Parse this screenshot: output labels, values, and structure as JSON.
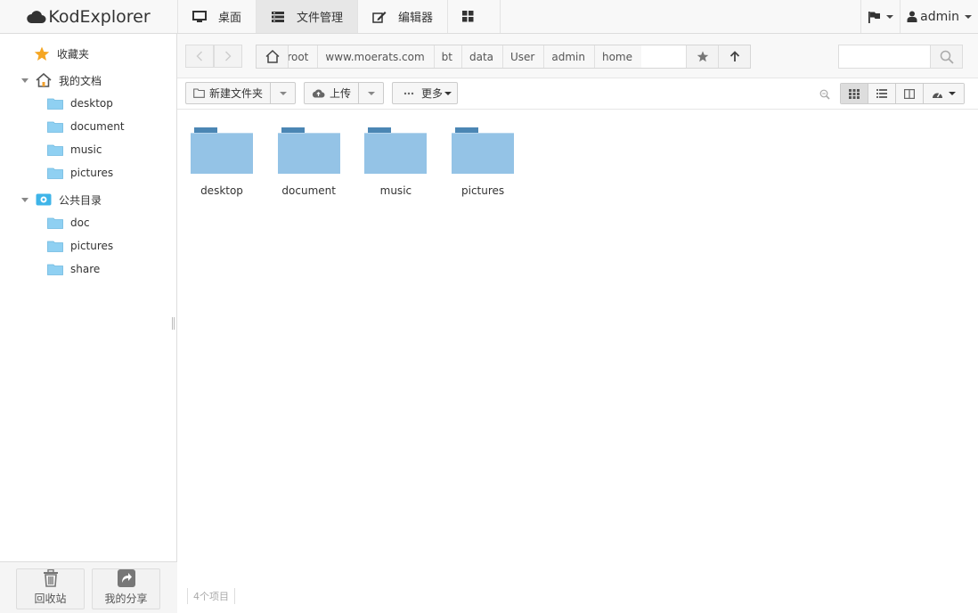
{
  "app": {
    "title": "KodExplorer"
  },
  "topnav": {
    "desktop": "桌面",
    "file_manager": "文件管理",
    "editor": "编辑器"
  },
  "topright": {
    "user": "admin"
  },
  "sidebar": {
    "favorites": "收藏夹",
    "my_docs": "我的文档",
    "my_docs_children": [
      "desktop",
      "document",
      "music",
      "pictures"
    ],
    "public": "公共目录",
    "public_children": [
      "doc",
      "pictures",
      "share"
    ],
    "recycle": "回收站",
    "my_share": "我的分享"
  },
  "path": {
    "crumbs": [
      "/wwroot",
      "www.moerats.com",
      "bt",
      "data",
      "User",
      "admin",
      "home"
    ]
  },
  "toolbar": {
    "new_folder": "新建文件夹",
    "upload": "上传",
    "more": "更多"
  },
  "files": [
    "desktop",
    "document",
    "music",
    "pictures"
  ],
  "status": {
    "count": "4个项目"
  },
  "colors": {
    "folder": "#94c3e6",
    "folder_tab": "#4b86b4",
    "sidebar_folder": "#8fd0f2"
  }
}
